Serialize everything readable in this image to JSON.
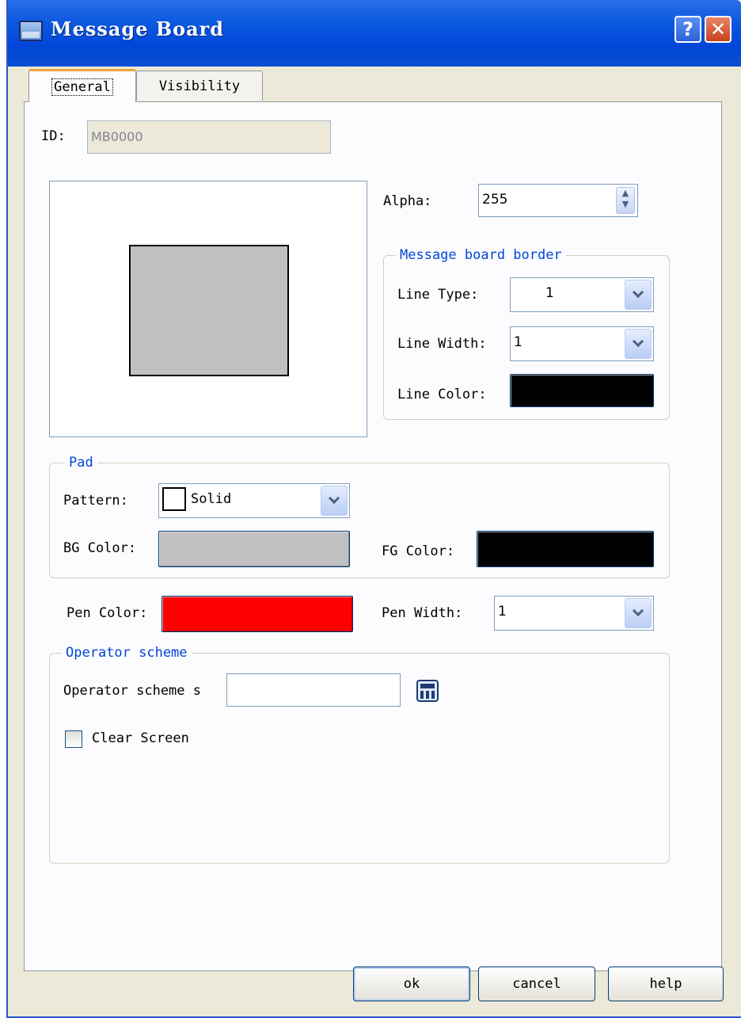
{
  "window": {
    "title": "Message Board",
    "help_glyph": "?",
    "close_glyph": "✕"
  },
  "tabs": [
    {
      "label": "General",
      "selected": true
    },
    {
      "label": "Visibility",
      "selected": false
    }
  ],
  "general": {
    "id_label": "ID:",
    "id_value": "MB0000",
    "alpha_label": "Alpha:",
    "alpha_value": "255",
    "border_group": {
      "legend": "Message board border",
      "line_type_label": "Line Type:",
      "line_type_value": "1",
      "line_width_label": "Line Width:",
      "line_width_value": "1",
      "line_color_label": "Line Color:",
      "line_color": "#000000"
    },
    "preview": {
      "fill_color": "#c0c0c0",
      "border_color": "#000000"
    },
    "pad_group": {
      "legend": "Pad",
      "pattern_label": "Pattern:",
      "pattern_value": "Solid",
      "bg_color_label": "BG Color:",
      "bg_color": "#c0c0c0",
      "fg_color_label": "FG Color:",
      "fg_color": "#000000"
    },
    "pen_color_label": "Pen Color:",
    "pen_color": "#ff0000",
    "pen_width_label": "Pen Width:",
    "pen_width_value": "1",
    "operator_group": {
      "legend": "Operator scheme",
      "scheme_label": "Operator scheme s",
      "scheme_value": "",
      "clear_screen_label": "Clear Screen",
      "clear_screen_checked": false
    }
  },
  "buttons": {
    "ok": "ok",
    "cancel": "cancel",
    "help": "help"
  }
}
